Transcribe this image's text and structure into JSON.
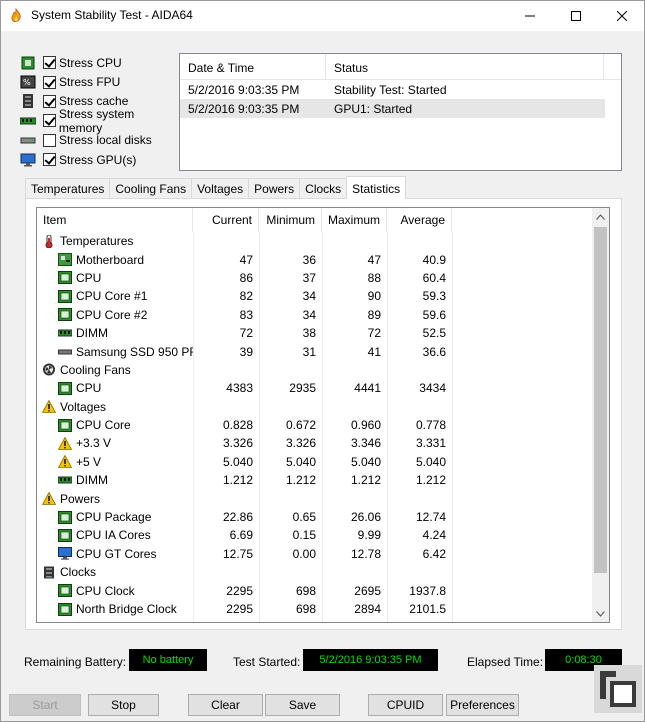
{
  "window": {
    "title": "System Stability Test - AIDA64"
  },
  "stress_options": [
    {
      "label": "Stress CPU",
      "checked": true,
      "icon": "cpu-icon"
    },
    {
      "label": "Stress FPU",
      "checked": true,
      "icon": "fpu-icon"
    },
    {
      "label": "Stress cache",
      "checked": true,
      "icon": "cache-icon"
    },
    {
      "label": "Stress system memory",
      "checked": true,
      "icon": "memory-icon"
    },
    {
      "label": "Stress local disks",
      "checked": false,
      "icon": "disk-icon"
    },
    {
      "label": "Stress GPU(s)",
      "checked": true,
      "icon": "gpu-icon"
    }
  ],
  "log": {
    "headers": {
      "date": "Date & Time",
      "status": "Status"
    },
    "rows": [
      {
        "date": "5/2/2016 9:03:35 PM",
        "status": "Stability Test: Started"
      },
      {
        "date": "5/2/2016 9:03:35 PM",
        "status": "GPU1: Started"
      }
    ]
  },
  "tabs": [
    "Temperatures",
    "Cooling Fans",
    "Voltages",
    "Powers",
    "Clocks",
    "Statistics"
  ],
  "active_tab": "Statistics",
  "stats": {
    "headers": {
      "item": "Item",
      "current": "Current",
      "minimum": "Minimum",
      "maximum": "Maximum",
      "average": "Average"
    },
    "rows": [
      {
        "type": "cat",
        "icon": "thermometer-icon",
        "item": "Temperatures"
      },
      {
        "type": "sub",
        "icon": "motherboard-icon",
        "item": "Motherboard",
        "cur": "47",
        "min": "36",
        "max": "47",
        "avg": "40.9"
      },
      {
        "type": "sub",
        "icon": "cpu-chip-icon",
        "item": "CPU",
        "cur": "86",
        "min": "37",
        "max": "88",
        "avg": "60.4"
      },
      {
        "type": "sub",
        "icon": "cpu-chip-icon",
        "item": "CPU Core #1",
        "cur": "82",
        "min": "34",
        "max": "90",
        "avg": "59.3"
      },
      {
        "type": "sub",
        "icon": "cpu-chip-icon",
        "item": "CPU Core #2",
        "cur": "83",
        "min": "34",
        "max": "89",
        "avg": "59.6"
      },
      {
        "type": "sub",
        "icon": "dimm-icon",
        "item": "DIMM",
        "cur": "72",
        "min": "38",
        "max": "72",
        "avg": "52.5"
      },
      {
        "type": "sub",
        "icon": "ssd-icon",
        "item": "Samsung SSD 950 PR...",
        "cur": "39",
        "min": "31",
        "max": "41",
        "avg": "36.6"
      },
      {
        "type": "cat",
        "icon": "fan-icon",
        "item": "Cooling Fans"
      },
      {
        "type": "sub",
        "icon": "cpu-chip-icon",
        "item": "CPU",
        "cur": "4383",
        "min": "2935",
        "max": "4441",
        "avg": "3434"
      },
      {
        "type": "cat",
        "icon": "warning-icon",
        "item": "Voltages"
      },
      {
        "type": "sub",
        "icon": "cpu-chip-icon",
        "item": "CPU Core",
        "cur": "0.828",
        "min": "0.672",
        "max": "0.960",
        "avg": "0.778"
      },
      {
        "type": "sub",
        "icon": "warning-icon",
        "item": "+3.3 V",
        "cur": "3.326",
        "min": "3.326",
        "max": "3.346",
        "avg": "3.331"
      },
      {
        "type": "sub",
        "icon": "warning-icon",
        "item": "+5 V",
        "cur": "5.040",
        "min": "5.040",
        "max": "5.040",
        "avg": "5.040"
      },
      {
        "type": "sub",
        "icon": "dimm-icon",
        "item": "DIMM",
        "cur": "1.212",
        "min": "1.212",
        "max": "1.212",
        "avg": "1.212"
      },
      {
        "type": "cat",
        "icon": "warning-icon",
        "item": "Powers"
      },
      {
        "type": "sub",
        "icon": "cpu-chip-icon",
        "item": "CPU Package",
        "cur": "22.86",
        "min": "0.65",
        "max": "26.06",
        "avg": "12.74"
      },
      {
        "type": "sub",
        "icon": "cpu-chip-icon",
        "item": "CPU IA Cores",
        "cur": "6.69",
        "min": "0.15",
        "max": "9.99",
        "avg": "4.24"
      },
      {
        "type": "sub",
        "icon": "monitor-icon",
        "item": "CPU GT Cores",
        "cur": "12.75",
        "min": "0.00",
        "max": "12.78",
        "avg": "6.42"
      },
      {
        "type": "cat",
        "icon": "clock-icon",
        "item": "Clocks"
      },
      {
        "type": "sub",
        "icon": "cpu-chip-icon",
        "item": "CPU Clock",
        "cur": "2295",
        "min": "698",
        "max": "2695",
        "avg": "1937.8"
      },
      {
        "type": "sub",
        "icon": "cpu-chip-icon",
        "item": "North Bridge Clock",
        "cur": "2295",
        "min": "698",
        "max": "2894",
        "avg": "2101.5"
      }
    ]
  },
  "status_bar": {
    "battery_label": "Remaining Battery:",
    "battery_value": "No battery",
    "started_label": "Test Started:",
    "started_value": "5/2/2016 9:03:35 PM",
    "elapsed_label": "Elapsed Time:",
    "elapsed_value": "0:08:30"
  },
  "buttons": {
    "start": "Start",
    "stop": "Stop",
    "clear": "Clear",
    "save": "Save",
    "cpuid": "CPUID",
    "preferences": "Preferences"
  },
  "colors": {
    "lcd_bg": "#000000",
    "lcd_fg": "#00e000",
    "selection": "#e6e6e6"
  }
}
